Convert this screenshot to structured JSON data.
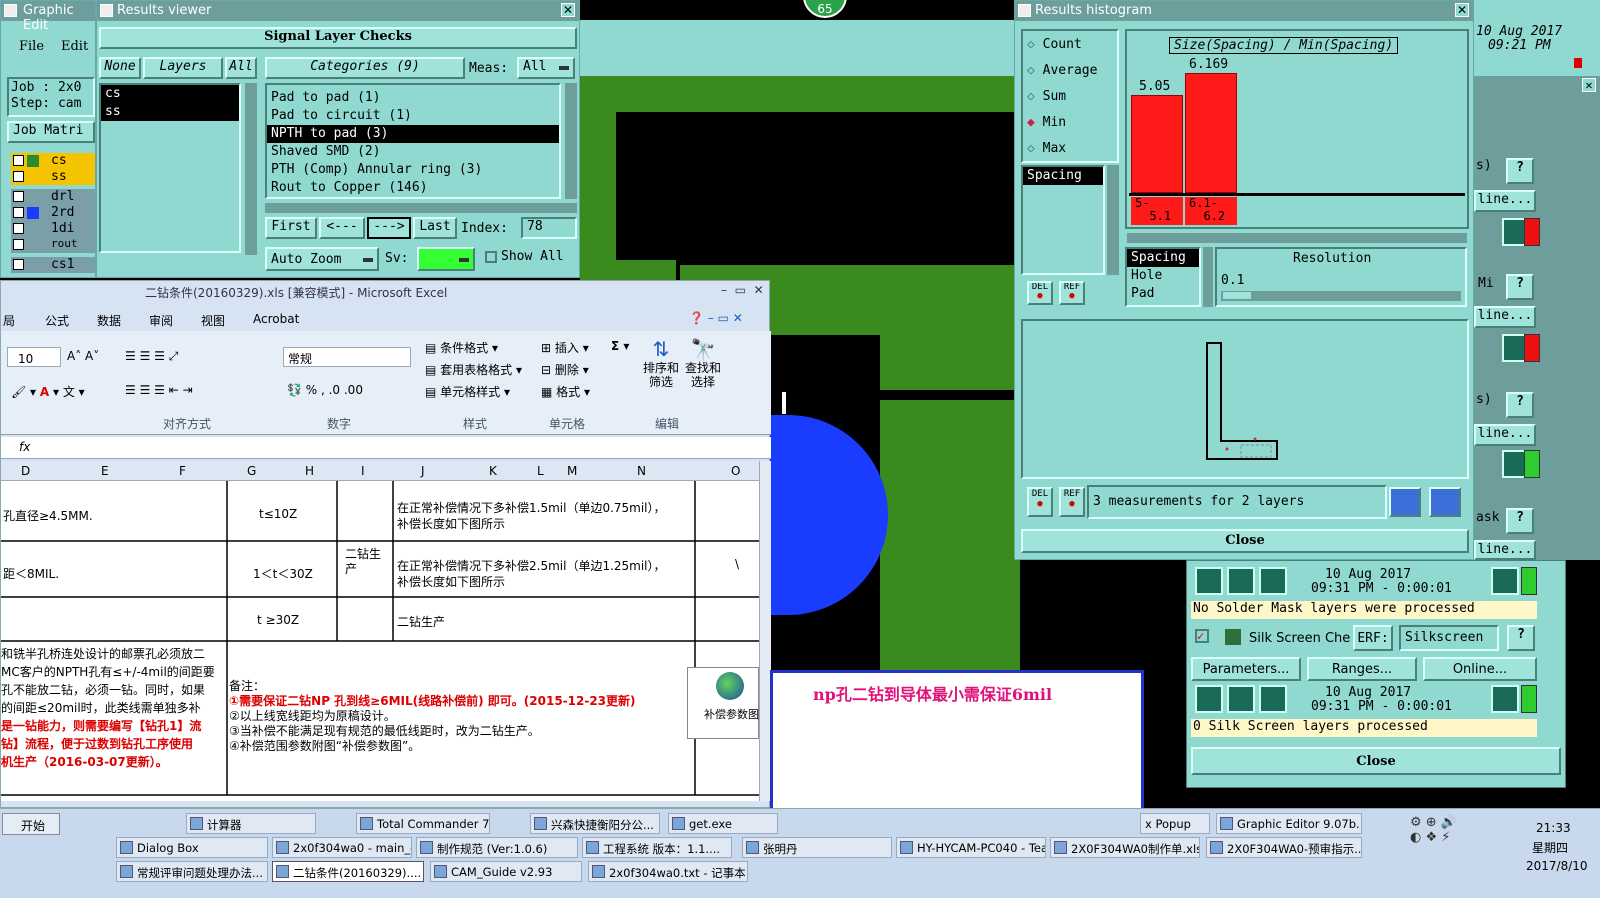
{
  "canvas": {
    "colors": {
      "bg": "#000000",
      "green": "#3a8a1e",
      "blue": "#1a3cff",
      "teal": "#8fd9d0"
    }
  },
  "badge": {
    "value": "65"
  },
  "graphic_editor": {
    "title": "Graphic Edit",
    "file": "File",
    "edit": "Edit",
    "job": "Job : 2x0",
    "step": "Step: cam",
    "job_matrix": "Job Matri",
    "layers": [
      "cs",
      "ss",
      "drl",
      "2rd",
      "1di",
      "rout",
      "cs1"
    ]
  },
  "results_viewer": {
    "title": "Results viewer",
    "header": "Signal Layer Checks",
    "none": "None",
    "layers_btn": "Layers",
    "all": "All",
    "categories": "Categories (9)",
    "meas": "Meas:",
    "meas_value": "All",
    "layer_list": [
      "cs",
      "ss"
    ],
    "category_list": [
      "Pad to pad (1)",
      "Pad to circuit (1)",
      "NPTH to pad (3)",
      "Shaved SMD (2)",
      "PTH (Comp) Annular ring (3)",
      "Rout to Copper (146)"
    ],
    "selected_index": 2,
    "first": "First",
    "prev": "<---",
    "next": "--->",
    "last": "Last",
    "index_label": "Index:",
    "index_value": "78",
    "auto_zoom": "Auto Zoom",
    "sv": "Sv:",
    "show_all": "Show All"
  },
  "histogram": {
    "title": "Results histogram",
    "modes": [
      "Count",
      "Average",
      "Sum",
      "Min",
      "Max"
    ],
    "selected_mode": "Min",
    "chart_title": "Size(Spacing) / Min(Spacing)",
    "bars": [
      {
        "value": "5.05",
        "range1": "5-",
        "range2": "5.1"
      },
      {
        "value": "6.169",
        "range1": "6.1-",
        "range2": "6.2"
      }
    ],
    "spacing_item": "Spacing",
    "list2": [
      "Spacing",
      "Hole",
      "Pad"
    ],
    "resolution": "Resolution",
    "resolution_value": "0.1",
    "measurements": "3 measurements for 2 layers",
    "close": "Close",
    "del": "DEL",
    "ref": "REF"
  },
  "right_panel": {
    "date": "10 Aug 2017",
    "time": "09:21 PM",
    "rows": [
      {
        "date": "10 Aug 2017",
        "time": "09:31 PM - 0:00:01",
        "msg": "No Solder Mask layers were processed"
      },
      {
        "date": "10 Aug 2017",
        "time": "09:31 PM - 0:00:01",
        "msg": "0 Silk Screen layers processed"
      }
    ],
    "silk_label": "Silk Screen Che",
    "erf": "ERF:",
    "silk_value": "Silkscreen",
    "parameters": "Parameters...",
    "ranges": "Ranges...",
    "online": "Online...",
    "close": "Close",
    "partial": [
      "s)",
      "line...",
      "Mi",
      "line...",
      "s)",
      "line...",
      "ask",
      "line..."
    ]
  },
  "excel": {
    "title": "二钻条件(20160329).xls  [兼容模式] - Microsoft Excel",
    "menu": [
      "局",
      "公式",
      "数据",
      "审阅",
      "视图",
      "Acrobat"
    ],
    "font_size": "10",
    "number_format": "常规",
    "groups": [
      "对齐方式",
      "数字",
      "样式",
      "单元格",
      "编辑"
    ],
    "style_btns": [
      "条件格式",
      "套用表格格式",
      "单元格样式"
    ],
    "cell_btns": [
      "插入",
      "删除",
      "格式"
    ],
    "sort": "排序和筛选",
    "find": "查找和选择",
    "fx": "fx",
    "cols": [
      "D",
      "E",
      "F",
      "G",
      "H",
      "I",
      "J",
      "K",
      "L",
      "M",
      "N",
      "O"
    ],
    "rows": [
      {
        "d": "孔直径≥4.5MM.",
        "g": "t≤10Z",
        "j1": "在正常补偿情况下多补偿1.5mil（单边0.75mil），",
        "j2": "补偿长度如下图所示"
      },
      {
        "d": "距＜8MIL.",
        "g": "1＜t＜30Z",
        "j1": "在正常补偿情况下多补偿2.5mil（单边1.25mil），",
        "j2": "补偿长度如下图所示",
        "o": "\\"
      },
      {
        "d": "",
        "g": "t ≥30Z",
        "j1": "二钻生产",
        "j2": ""
      }
    ],
    "merged": "二钻生产",
    "notes_left": [
      "和铣半孔桥连处设计的邮票孔必须放二",
      "",
      "MC客户的NPTH孔有≤+/-4mil的间距要",
      "孔不能放二钻，必须一钻。同时，如果",
      "的间距≤20mil时，此类线需单独多补",
      "是一钻能力，则需要编写【钻孔1】流",
      "钻】流程，便于过数到钻孔工序使用",
      "机生产（2016-03-07更新）。"
    ],
    "notes_right": [
      "备注：",
      "①需要保证二钻NP 孔到线≥6MIL(线路补偿前) 即可。(2015-12-23更新)",
      "②以上线宽线距均为原稿设计。",
      "③当补偿不能满足现有规范的最低线距时，改为二钻生产。",
      "④补偿范围参数附图“补偿参数图”。"
    ],
    "icon_label": "补偿参数图"
  },
  "note_box": {
    "text": "np孔二钻到导体最小需保证6mil"
  },
  "taskbar": {
    "start": "开始",
    "row1": [
      "Dialog Box",
      "计算器",
      "Total Commander 7....",
      "兴森快捷衡阳分公...",
      "get.exe",
      "x Popup",
      "Graphic Editor 9.07b..."
    ],
    "row2": [
      "2x0f304wa0 - main_qa",
      "制作规范 (Ver:1.0.6)",
      "工程系统  版本：1.1....",
      "张明丹",
      "HY-HYCAM-PC040 - Tea...",
      "2X0F304WA0制作单.xls...",
      "2X0F304WA0-预审指示..."
    ],
    "row3": [
      "常规评审问题处理办法...",
      "二钻条件(20160329)....",
      "CAM_Guide v2.93",
      "2x0f304wa0.txt - 记事本"
    ],
    "time": "21:33",
    "weekday": "星期四",
    "date": "2017/8/10"
  }
}
